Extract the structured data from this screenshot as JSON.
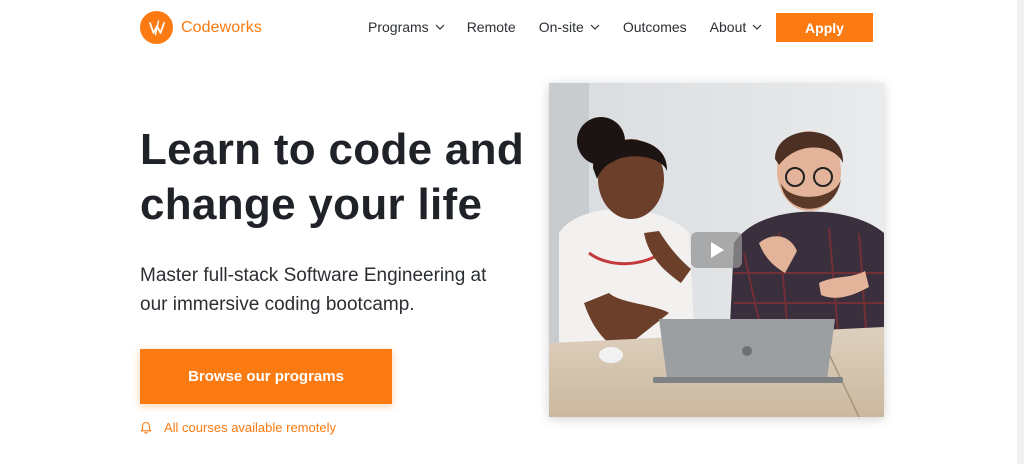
{
  "brand": {
    "name": "Codeworks",
    "accent": "#fc7a12"
  },
  "nav": {
    "items": [
      {
        "label": "Programs",
        "has_dropdown": true
      },
      {
        "label": "Remote",
        "has_dropdown": false
      },
      {
        "label": "On-site",
        "has_dropdown": true
      },
      {
        "label": "Outcomes",
        "has_dropdown": false
      },
      {
        "label": "About",
        "has_dropdown": true
      }
    ],
    "apply_label": "Apply"
  },
  "hero": {
    "title_line1": "Learn to code and",
    "title_line2": "change your life",
    "subtitle_line1": "Master full-stack Software Engineering at",
    "subtitle_line2": "our immersive coding bootcamp.",
    "cta_label": "Browse our programs",
    "note": "All courses available remotely",
    "note_icon": "bell-icon"
  },
  "video": {
    "play_icon": "play-icon"
  }
}
